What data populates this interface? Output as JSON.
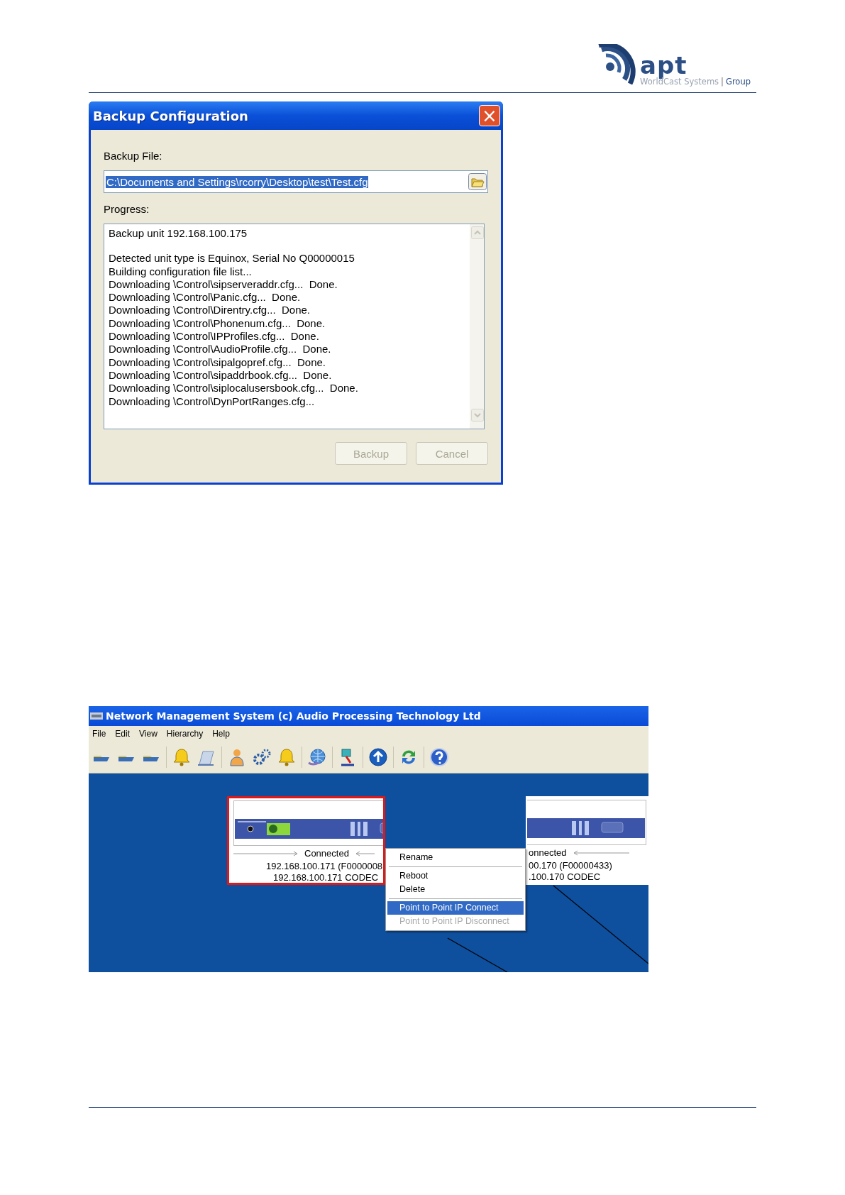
{
  "logo": {
    "wordmark": "apt",
    "tagline": "WorldCast Systems",
    "separator": "|",
    "group": "Group"
  },
  "backup_dialog": {
    "title": "Backup Configuration",
    "close_label": "×",
    "file_label": "Backup File:",
    "file_value": "C:\\Documents and Settings\\rcorry\\Desktop\\test\\Test.cfg",
    "file_value_selected": true,
    "progress_label": "Progress:",
    "progress_blocks": [
      [
        "Backup unit 192.168.100.175"
      ],
      [
        "Detected unit type is Equinox, Serial No Q00000015",
        "Building configuration file list...",
        "Downloading \\Control\\sipserveraddr.cfg...  Done.",
        "Downloading \\Control\\Panic.cfg...  Done.",
        "Downloading \\Control\\Direntry.cfg...  Done.",
        "Downloading \\Control\\Phonenum.cfg...  Done.",
        "Downloading \\Control\\IPProfiles.cfg...  Done.",
        "Downloading \\Control\\AudioProfile.cfg...  Done.",
        "Downloading \\Control\\sipalgopref.cfg...  Done.",
        "Downloading \\Control\\sipaddrbook.cfg...  Done.",
        "Downloading \\Control\\siplocalusersbook.cfg...  Done.",
        "Downloading \\Control\\DynPortRanges.cfg..."
      ]
    ],
    "buttons": [
      {
        "label": "Backup",
        "disabled": true
      },
      {
        "label": "Cancel",
        "disabled": true
      }
    ]
  },
  "nms_window": {
    "title": "Network Management System (c) Audio Processing Technology Ltd",
    "menu": [
      "File",
      "Edit",
      "View",
      "Hierarchy",
      "Help"
    ],
    "devices": [
      {
        "status": "Connected",
        "address": "192.168.100.171 (F0000008",
        "name": "192.168.100.171 CODEC",
        "selected": true
      },
      {
        "status": "onnected",
        "address": "00.170 (F00000433)",
        "name": ".100.170 CODEC",
        "selected": false
      }
    ],
    "context_menu": [
      {
        "kind": "item",
        "label": "Rename",
        "selected": false,
        "disabled": false
      },
      {
        "kind": "separator"
      },
      {
        "kind": "item",
        "label": "Reboot",
        "selected": false,
        "disabled": false
      },
      {
        "kind": "item",
        "label": "Delete",
        "selected": false,
        "disabled": false
      },
      {
        "kind": "separator"
      },
      {
        "kind": "item",
        "label": "Point to Point IP Connect",
        "selected": true,
        "disabled": false
      },
      {
        "kind": "item",
        "label": "Point to Point IP Disconnect",
        "selected": false,
        "disabled": true
      }
    ]
  }
}
